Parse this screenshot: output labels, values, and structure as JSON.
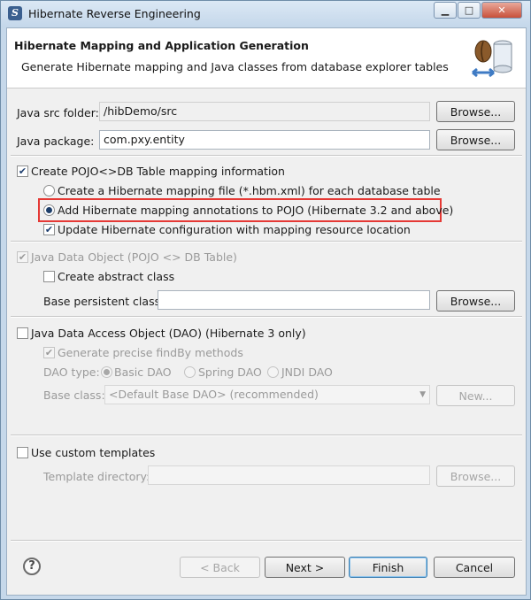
{
  "window": {
    "title": "Hibernate Reverse Engineering",
    "controls": {
      "minimize": "▁",
      "maximize": "□",
      "close": "✕"
    }
  },
  "banner": {
    "title": "Hibernate Mapping and Application Generation",
    "subtitle": "Generate Hibernate mapping and Java classes from database explorer tables"
  },
  "src_folder": {
    "label": "Java src folder:",
    "value": "/hibDemo/src",
    "browse": "Browse..."
  },
  "package": {
    "label": "Java package:",
    "value": "com.pxy.entity",
    "browse": "Browse..."
  },
  "mapping": {
    "label": "Create POJO<>DB Table mapping information",
    "checked": "✔",
    "option_hbm": "Create a Hibernate mapping file (*.hbm.xml) for each database table",
    "option_annotations": "Add Hibernate mapping annotations to POJO (Hibernate 3.2 and above)",
    "update_config": "Update Hibernate configuration with mapping resource location",
    "update_checked": "✔"
  },
  "jdo": {
    "label": "Java Data Object (POJO <> DB Table)",
    "checked": "✔",
    "abstract_label": "Create abstract class",
    "base_label": "Base persistent class:",
    "base_value": "",
    "browse": "Browse..."
  },
  "dao": {
    "label": "Java Data Access Object (DAO) (Hibernate 3 only)",
    "precise_label": "Generate precise findBy methods",
    "precise_checked": "✔",
    "type_label": "DAO type:",
    "type_basic": "Basic DAO",
    "type_spring": "Spring DAO",
    "type_jndi": "JNDI DAO",
    "base_label": "Base class:",
    "base_value": "<Default Base DAO> (recommended)",
    "new_button": "New..."
  },
  "templates": {
    "label": "Use custom templates",
    "dir_label": "Template directory:",
    "dir_value": "",
    "browse": "Browse..."
  },
  "footer": {
    "help": "?",
    "back": "< Back",
    "next": "Next >",
    "finish": "Finish",
    "cancel": "Cancel"
  }
}
